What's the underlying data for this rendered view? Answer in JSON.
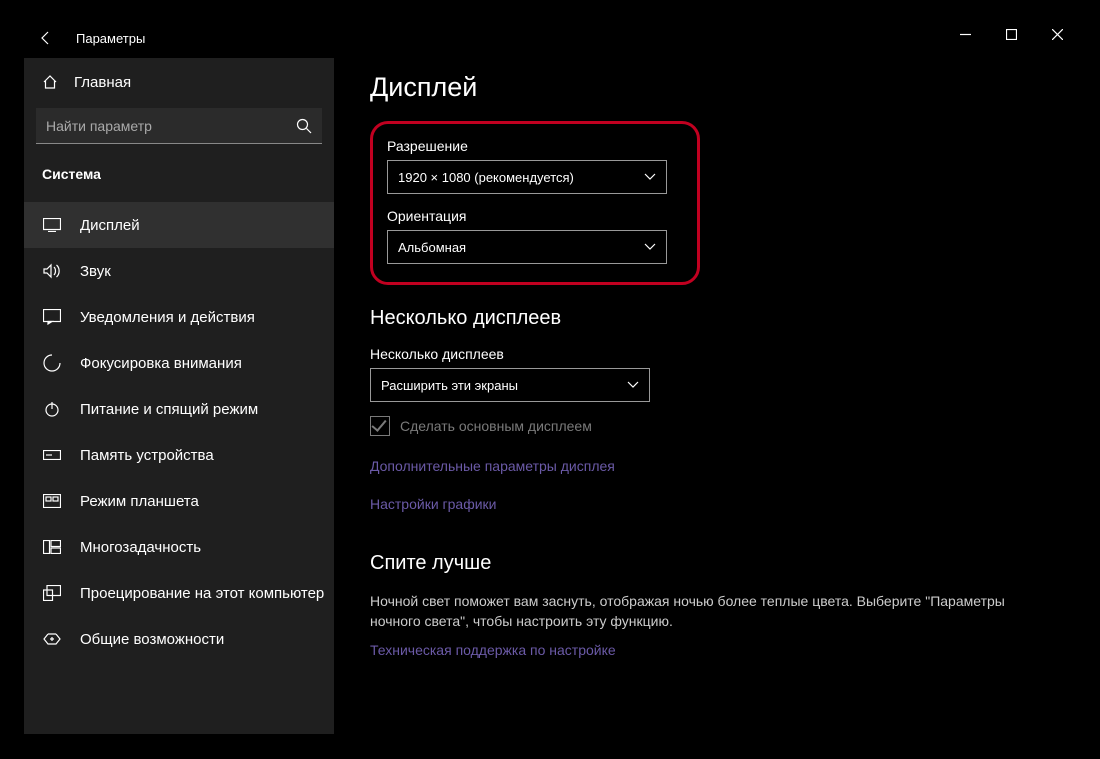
{
  "titlebar": {
    "title": "Параметры"
  },
  "sidebar": {
    "home_label": "Главная",
    "search_placeholder": "Найти параметр",
    "category": "Система",
    "items": [
      {
        "label": "Дисплей"
      },
      {
        "label": "Звук"
      },
      {
        "label": "Уведомления и действия"
      },
      {
        "label": "Фокусировка внимания"
      },
      {
        "label": "Питание и спящий режим"
      },
      {
        "label": "Память устройства"
      },
      {
        "label": "Режим планшета"
      },
      {
        "label": "Многозадачность"
      },
      {
        "label": "Проецирование на этот компьютер"
      },
      {
        "label": "Общие возможности"
      }
    ]
  },
  "main": {
    "heading": "Дисплей",
    "resolution_label": "Разрешение",
    "resolution_value": "1920 × 1080 (рекомендуется)",
    "orientation_label": "Ориентация",
    "orientation_value": "Альбомная",
    "multi_heading": "Несколько дисплеев",
    "multi_label": "Несколько дисплеев",
    "multi_value": "Расширить эти экраны",
    "make_primary": "Сделать основным дисплеем",
    "link_advanced": "Дополнительные параметры дисплея",
    "link_graphics": "Настройки графики",
    "sleep_heading": "Спите лучше",
    "sleep_desc": "Ночной свет поможет вам заснуть, отображая ночью более теплые цвета. Выберите \"Параметры ночного света\", чтобы настроить эту функцию.",
    "link_support": "Техническая поддержка по настройке"
  }
}
